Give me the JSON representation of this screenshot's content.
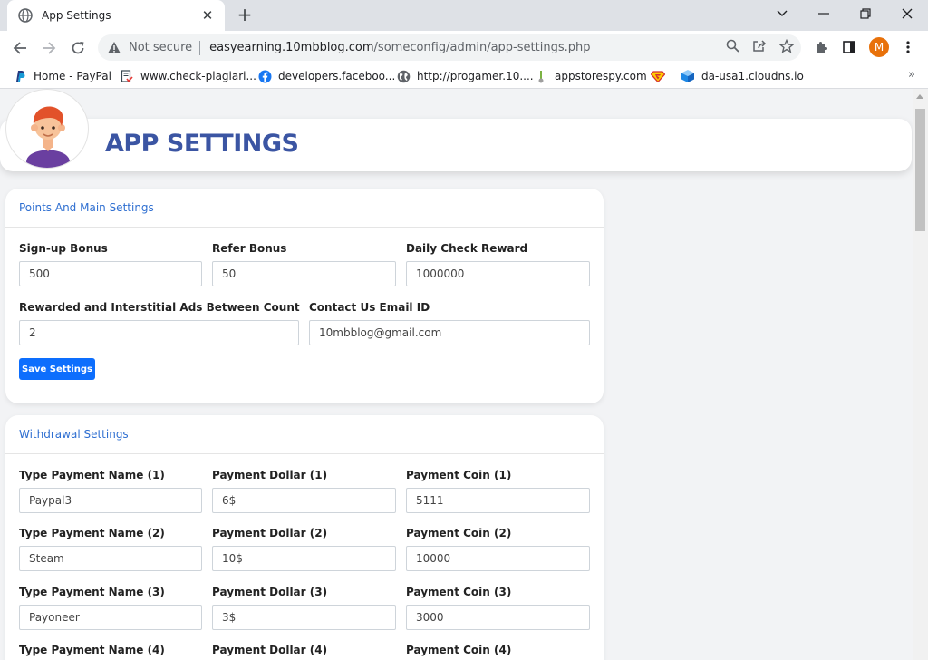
{
  "browser": {
    "tab_title": "App Settings",
    "tab_close": "✕",
    "new_tab": "+",
    "security_label": "Not secure",
    "url_host": "easyearning.10mbblog.com",
    "url_path": "/someconfig/admin/app-settings.php",
    "profile_initial": "M",
    "bookmarks": [
      {
        "label": "Home - PayPal",
        "icon": "paypal-icon"
      },
      {
        "label": "www.check-plagiari...",
        "icon": "document-check-icon"
      },
      {
        "label": "developers.faceboo...",
        "icon": "facebook-icon"
      },
      {
        "label": "http://progamer.10....",
        "icon": "globe-icon"
      },
      {
        "label": "appstorespy.com",
        "icon": "appstorespy-icon"
      },
      {
        "label": "",
        "icon": "superman-shield-icon"
      },
      {
        "label": "da-usa1.cloudns.io",
        "icon": "cube-icon"
      }
    ],
    "bookmarks_more": "»"
  },
  "page": {
    "title": "APP SETTINGS"
  },
  "points_card": {
    "title": "Points And Main Settings",
    "signup": {
      "label": "Sign-up Bonus",
      "value": "500"
    },
    "refer": {
      "label": "Refer Bonus",
      "value": "50"
    },
    "daily": {
      "label": "Daily Check Reward",
      "value": "1000000"
    },
    "ads": {
      "label": "Rewarded and Interstitial Ads Between Count",
      "value": "2"
    },
    "email": {
      "label": "Contact Us Email ID",
      "value": "10mbblog@gmail.com"
    },
    "save_label": "Save Settings"
  },
  "withdrawal_card": {
    "title": "Withdrawal Settings",
    "rows": [
      {
        "name_label": "Type Payment Name (1)",
        "name_value": "Paypal3",
        "dollar_label": "Payment Dollar (1)",
        "dollar_value": "6$",
        "coin_label": "Payment Coin (1)",
        "coin_value": "5111"
      },
      {
        "name_label": "Type Payment Name (2)",
        "name_value": "Steam",
        "dollar_label": "Payment Dollar (2)",
        "dollar_value": "10$",
        "coin_label": "Payment Coin (2)",
        "coin_value": "10000"
      },
      {
        "name_label": "Type Payment Name (3)",
        "name_value": "Payoneer",
        "dollar_label": "Payment Dollar (3)",
        "dollar_value": "3$",
        "coin_label": "Payment Coin (3)",
        "coin_value": "3000"
      },
      {
        "name_label": "Type Payment Name (4)",
        "name_value": "",
        "dollar_label": "Payment Dollar (4)",
        "dollar_value": "",
        "coin_label": "Payment Coin (4)",
        "coin_value": ""
      }
    ]
  },
  "colors": {
    "title_blue": "#3b55a3",
    "section_link_blue": "#2f6fd1",
    "primary_button": "#0d6efd",
    "profile_orange": "#e8710a"
  }
}
